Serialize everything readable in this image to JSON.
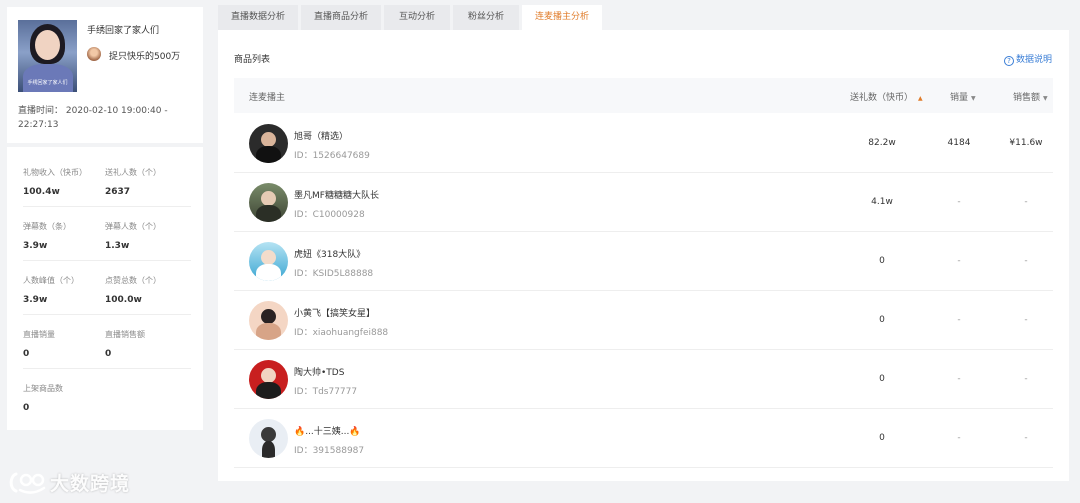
{
  "profile": {
    "anchor_name": "手绣回家了家人们",
    "avatar_caption": "手绣回家了家人们",
    "sub_name": "捉只快乐的500万",
    "live_time_label": "直播时间：",
    "live_time_value": "2020-02-10 19:00:40 - 22:27:13"
  },
  "stats": [
    {
      "left_label": "礼物收入（快币）",
      "left_value": "100.4w",
      "right_label": "送礼人数（个）",
      "right_value": "2637"
    },
    {
      "left_label": "弹幕数（条）",
      "left_value": "3.9w",
      "right_label": "弹幕人数（个）",
      "right_value": "1.3w"
    },
    {
      "left_label": "人数峰值（个）",
      "left_value": "3.9w",
      "right_label": "点赞总数（个）",
      "right_value": "100.0w"
    },
    {
      "left_label": "直播销量",
      "left_value": "0",
      "right_label": "直播销售额",
      "right_value": "0"
    },
    {
      "left_label": "上架商品数",
      "left_value": "0"
    }
  ],
  "tabs": [
    {
      "label": "直播数据分析"
    },
    {
      "label": "直播商品分析"
    },
    {
      "label": "互动分析"
    },
    {
      "label": "粉丝分析"
    },
    {
      "label": "连麦播主分析"
    }
  ],
  "active_tab": 4,
  "panel": {
    "title": "商品列表",
    "data_link": "数据说明",
    "help_icon": "?"
  },
  "table": {
    "columns": {
      "anchor": "连麦播主",
      "gift": "送礼数（快币）",
      "sales": "销量",
      "revenue": "销售额"
    },
    "sort_up_glyph": "▲",
    "sort_down_glyph": "▼",
    "rows": [
      {
        "name": "旭哥（精选）",
        "id": "ID：1526647689",
        "gift": "82.2w",
        "sales": "4184",
        "revenue": "¥11.6w"
      },
      {
        "name": "墨凡MF糖糖糖大队长",
        "id": "ID：C10000928",
        "gift": "4.1w",
        "sales": "-",
        "revenue": "-"
      },
      {
        "name": "虎妞《318大队》",
        "id": "ID：KSID5L88888",
        "gift": "0",
        "sales": "-",
        "revenue": "-"
      },
      {
        "name": "小黄飞【搞笑女星】",
        "id": "ID：xiaohuangfei888",
        "gift": "0",
        "sales": "-",
        "revenue": "-"
      },
      {
        "name": "陶大帅•TDS",
        "id": "ID：Tds77777",
        "gift": "0",
        "sales": "-",
        "revenue": "-"
      },
      {
        "name": "🔥...十三姨...🔥",
        "id": "ID：391588987",
        "gift": "0",
        "sales": "-",
        "revenue": "-"
      }
    ]
  },
  "watermark": {
    "text": "大数跨境"
  },
  "colors": {
    "accent_orange": "#e07c2a",
    "link_blue": "#3a7ed6",
    "background": "#f2f3f5"
  }
}
